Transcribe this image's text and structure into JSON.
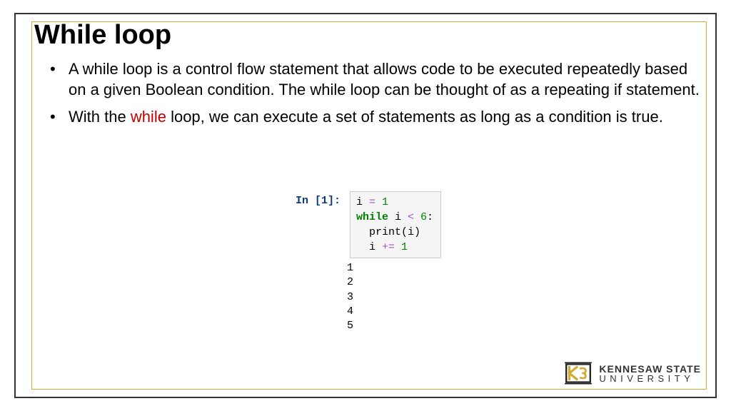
{
  "title": "While loop",
  "bullets": [
    {
      "text": "A while loop is a control flow statement that allows code to be executed repeatedly based on a given Boolean condition. The while loop can be thought of as a repeating if statement."
    },
    {
      "prefix": "With the ",
      "keyword": "while",
      "suffix": " loop, we can execute a set of statements as long as a condition is true."
    }
  ],
  "code": {
    "in_label": "In [1]:",
    "lines": {
      "l1_var": "i ",
      "l1_op": "=",
      "l1_num": " 1",
      "l2_kw": "while",
      "l2_var": " i ",
      "l2_op": "<",
      "l2_num": " 6",
      "l2_colon": ":",
      "l3_indent": "  ",
      "l3_fn": "print",
      "l3_p1": "(",
      "l3_arg": "i",
      "l3_p2": ")",
      "l4_indent": "  ",
      "l4_var": "i ",
      "l4_op": "+=",
      "l4_num": " 1"
    },
    "output": "1\n2\n3\n4\n5"
  },
  "logo": {
    "line1": "KENNESAW STATE",
    "line2": "UNIVERSITY"
  }
}
